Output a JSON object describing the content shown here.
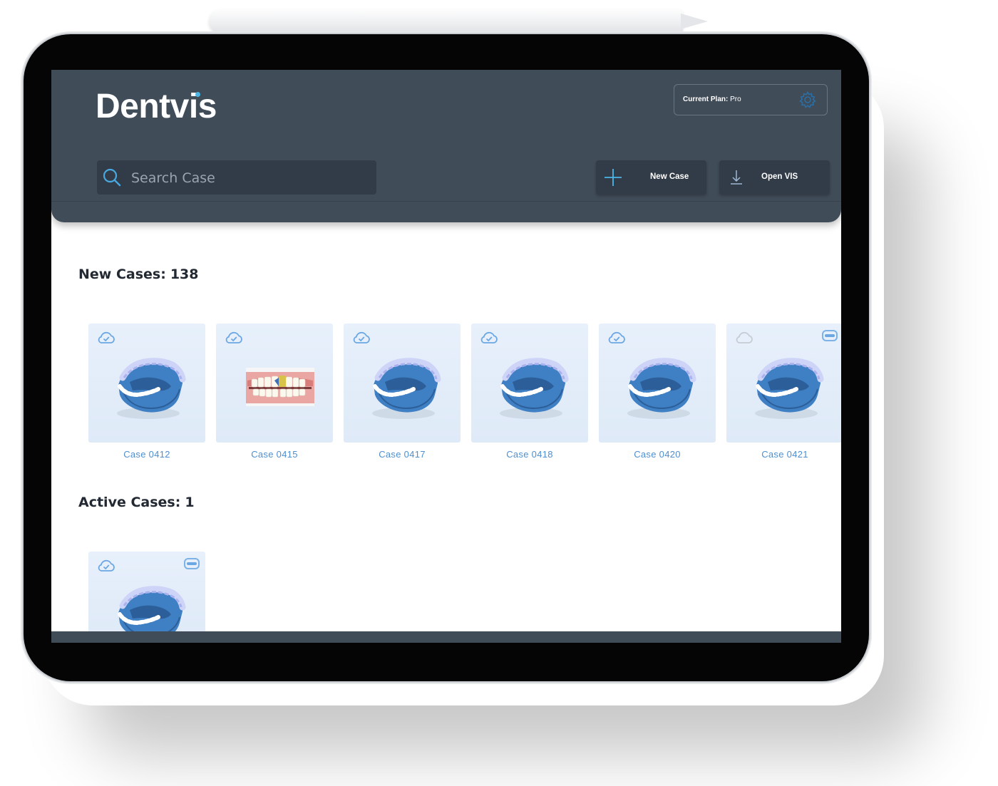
{
  "app": {
    "logo": "Dentvis",
    "plan_label": "Current Plan:",
    "plan_value": "Pro"
  },
  "search": {
    "placeholder": "Search Case"
  },
  "toolbar": {
    "new_case": "New Case",
    "open_vis": "Open VIS"
  },
  "sections": {
    "new_cases": {
      "title": "New Cases:",
      "count": "138",
      "cards": [
        {
          "label": "Case 0412",
          "cloud": "cloud-check-icon",
          "image": "jaw-model"
        },
        {
          "label": "Case 0415",
          "cloud": "cloud-check-icon",
          "image": "teeth-photo"
        },
        {
          "label": "Case 0417",
          "cloud": "cloud-check-icon",
          "image": "jaw-model"
        },
        {
          "label": "Case 0418",
          "cloud": "cloud-check-icon",
          "image": "jaw-model"
        },
        {
          "label": "Case 0420",
          "cloud": "cloud-check-icon",
          "image": "jaw-model"
        },
        {
          "label": "Case 0421",
          "cloud": "cloud-empty-icon",
          "image": "jaw-model",
          "badge": true
        }
      ]
    },
    "active_cases": {
      "title": "Active Cases:",
      "count": "1",
      "cards": [
        {
          "label": "",
          "cloud": "cloud-check-icon",
          "image": "jaw-model",
          "badge": true
        }
      ]
    }
  },
  "colors": {
    "header": "#414c59",
    "control": "#323c48",
    "accent": "#4bb6e6",
    "card_bg": "#e4eefa",
    "card_label": "#4e8fd0",
    "model_blue": "#3b78bd"
  }
}
